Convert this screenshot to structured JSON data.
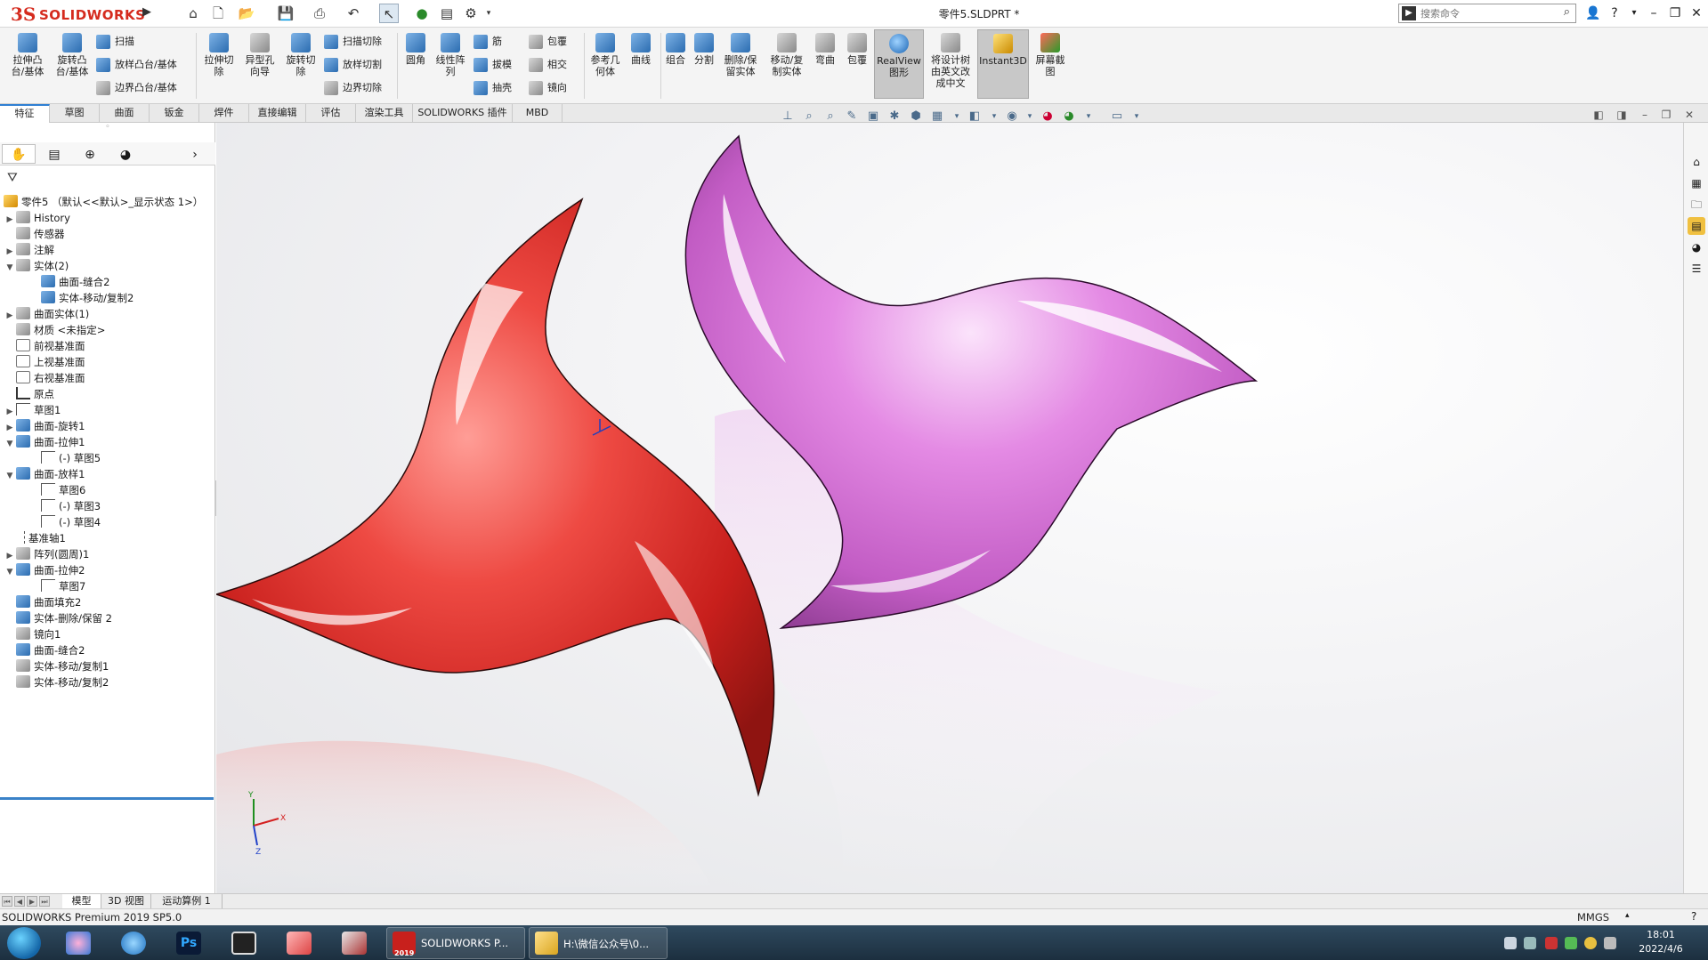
{
  "app": {
    "logo_ds": "3S",
    "logo_name": "SOLIDWORKS",
    "document_title": "零件5.SLDPRT *",
    "search_placeholder": "搜索命令"
  },
  "ribbon": {
    "features": {
      "extrude_boss": "拉伸凸\n台/基体",
      "revolve_boss": "旋转凸\n台/基体",
      "sweep": "扫描",
      "loft": "放样凸台/基体",
      "boundary": "边界凸台/基体",
      "extrude_cut": "拉伸切\n除",
      "hole_wizard": "异型孔\n向导",
      "revolve_cut": "旋转切\n除",
      "sweep_cut": "扫描切除",
      "loft_cut": "放样切割",
      "boundary_cut": "边界切除",
      "fillet": "圆角",
      "linear_pattern": "线性阵\n列",
      "rib": "筋",
      "draft": "拔模",
      "shell": "抽壳",
      "wrap": "包覆",
      "intersect": "相交",
      "mirror": "镜向",
      "ref_geometry": "参考几\n何体",
      "curves": "曲线",
      "combine": "组合",
      "split": "分割",
      "delete_keep": "删除/保\n留实体",
      "move_copy": "移动/复\n制实体",
      "flex": "弯曲",
      "wrap2": "包覆",
      "realview": "RealView\n图形",
      "translate_tree": "将设计树\n由英文改\n成中文",
      "instant3d": "Instant3D",
      "screenshot": "屏幕截\n图"
    }
  },
  "tabs": [
    {
      "label": "特征"
    },
    {
      "label": "草图"
    },
    {
      "label": "曲面"
    },
    {
      "label": "钣金"
    },
    {
      "label": "焊件"
    },
    {
      "label": "直接编辑"
    },
    {
      "label": "评估"
    },
    {
      "label": "渲染工具"
    },
    {
      "label": "SOLIDWORKS 插件"
    },
    {
      "label": "MBD"
    }
  ],
  "tree": {
    "root": "零件5 （默认<<默认>_显示状态 1>）",
    "items": [
      {
        "label": "History"
      },
      {
        "label": "传感器"
      },
      {
        "label": "注解"
      },
      {
        "label": "实体(2)"
      },
      {
        "label": "曲面-缝合2"
      },
      {
        "label": "实体-移动/复制2"
      },
      {
        "label": "曲面实体(1)"
      },
      {
        "label": "材质 <未指定>"
      },
      {
        "label": "前视基准面"
      },
      {
        "label": "上视基准面"
      },
      {
        "label": "右视基准面"
      },
      {
        "label": "原点"
      },
      {
        "label": "草图1"
      },
      {
        "label": "曲面-旋转1"
      },
      {
        "label": "曲面-拉伸1"
      },
      {
        "label": "(-) 草图5"
      },
      {
        "label": "曲面-放样1"
      },
      {
        "label": "草图6"
      },
      {
        "label": "(-) 草图3"
      },
      {
        "label": "(-) 草图4"
      },
      {
        "label": "基准轴1"
      },
      {
        "label": "阵列(圆周)1"
      },
      {
        "label": "曲面-拉伸2"
      },
      {
        "label": "草图7"
      },
      {
        "label": "曲面填充2"
      },
      {
        "label": "实体-删除/保留 2"
      },
      {
        "label": "镜向1"
      },
      {
        "label": "曲面-缝合2"
      },
      {
        "label": "实体-移动/复制1"
      },
      {
        "label": "实体-移动/复制2"
      }
    ]
  },
  "bottom_tabs": [
    {
      "label": "模型"
    },
    {
      "label": "3D 视图"
    },
    {
      "label": "运动算例 1"
    }
  ],
  "status": {
    "product": "SOLIDWORKS Premium 2019 SP5.0",
    "units": "MMGS"
  },
  "taskbar": {
    "solidworks_label": "SOLIDWORKS P...",
    "solidworks_badge": "2019",
    "folder_label": "H:\\微信公众号\\0...",
    "ps_label": "Ps",
    "time": "18:01",
    "date": "2022/4/6"
  },
  "triad": {
    "x": "X",
    "y": "Y",
    "z": "Z"
  },
  "colors": {
    "red_body": "#e8322e",
    "pink_body": "#d96bd9",
    "accent": "#2f7fd3"
  }
}
